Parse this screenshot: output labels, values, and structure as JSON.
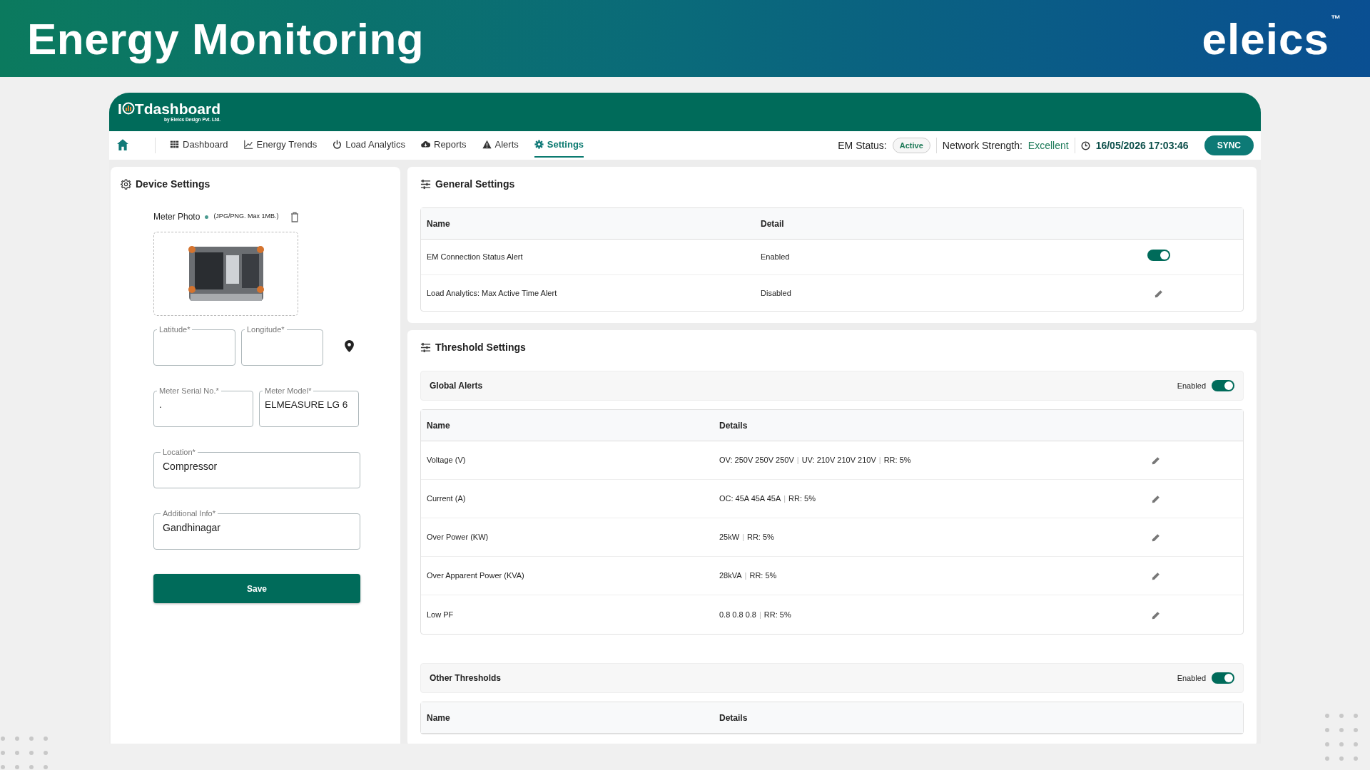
{
  "banner": {
    "title": "Energy Monitoring",
    "logo": "eleics",
    "logo_mark": "™"
  },
  "app": {
    "brand_parts": [
      "I",
      "Tdashboard"
    ],
    "tagline": "by Eleics Design Pvt. Ltd."
  },
  "nav": [
    {
      "kind": "home",
      "selected": false
    },
    {
      "kind": "grid",
      "label": "Dashboard",
      "selected": false
    },
    {
      "kind": "trend",
      "label": "Energy Trends",
      "selected": false
    },
    {
      "kind": "power",
      "label": "Load Analytics",
      "selected": false
    },
    {
      "kind": "cloud",
      "label": "Reports",
      "selected": false
    },
    {
      "kind": "warning",
      "label": "Alerts",
      "selected": false
    },
    {
      "kind": "gear",
      "label": "Settings",
      "selected": true
    }
  ],
  "status": {
    "em_label": "EM Status:",
    "em_value": "Active",
    "network_label": "Network Strength:",
    "network_value": "Excellent",
    "datetime": "16/05/2026 17:03:46",
    "sync": "SYNC"
  },
  "device_settings": {
    "title": "Device Settings",
    "photo_label": "Meter Photo",
    "photo_hint": "(JPG/PNG. Max 1MB.)",
    "field_rows": [
      [
        {
          "label": "Latitude*"
        },
        {
          "label": "Longitude*"
        }
      ],
      [
        {
          "label": "Meter Serial No.*",
          "value": "."
        },
        {
          "label": "Meter Model*",
          "value": "ELMEASURE LG 6"
        }
      ],
      [
        {
          "label": "Location*",
          "value": "Compressor"
        }
      ],
      [
        {
          "label": "Additional Info*",
          "value": "Gandhinagar"
        }
      ]
    ],
    "save": "Save"
  },
  "general_settings": {
    "title": "General Settings",
    "columns": [
      "Name",
      "Detail"
    ],
    "rows": [
      {
        "name": "EM Connection Status Alert",
        "detail": "Enabled",
        "kind": "toggle",
        "on": true
      },
      {
        "name": "Load Analytics: Max Active Time Alert",
        "detail": "Disabled",
        "kind": "edit"
      }
    ]
  },
  "threshold_settings": {
    "title": "Threshold Settings",
    "sections": [
      {
        "title": "Global Alerts",
        "status": "Enabled",
        "on": true,
        "columns": [
          "Name",
          "Details"
        ],
        "separator": "|",
        "rows": [
          {
            "name": "Voltage (V)",
            "details": [
              "OV: 250V 250V 250V",
              "UV: 210V 210V 210V",
              "RR: 5%"
            ]
          },
          {
            "name": "Current (A)",
            "details": [
              "OC: 45A 45A 45A",
              "RR: 5%"
            ]
          },
          {
            "name": "Over Power (KW)",
            "details": [
              "25kW",
              "RR: 5%"
            ]
          },
          {
            "name": "Over Apparent Power (KVA)",
            "details": [
              "28kVA",
              "RR: 5%"
            ]
          },
          {
            "name": "Low PF",
            "details": [
              "0.8 0.8 0.8",
              "RR: 5%"
            ]
          }
        ]
      },
      {
        "title": "Other Thresholds",
        "status": "Enabled",
        "on": true,
        "columns": [
          "Name",
          "Details"
        ]
      }
    ]
  }
}
